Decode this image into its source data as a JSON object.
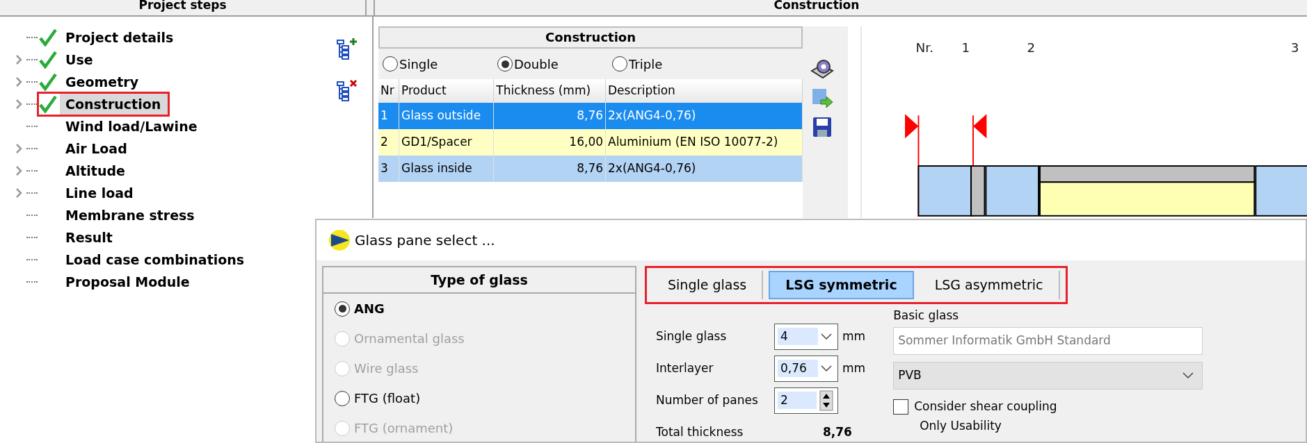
{
  "headers": {
    "left": "Project steps",
    "right": "Construction"
  },
  "tree": [
    {
      "label": "Project details",
      "checked": true,
      "expandable": false,
      "selected": false,
      "highlighted": false
    },
    {
      "label": "Use",
      "checked": true,
      "expandable": true,
      "selected": false,
      "highlighted": false
    },
    {
      "label": "Geometry",
      "checked": true,
      "expandable": true,
      "selected": false,
      "highlighted": false
    },
    {
      "label": "Construction",
      "checked": true,
      "expandable": true,
      "selected": true,
      "highlighted": true
    },
    {
      "label": "Wind load/Lawine",
      "checked": false,
      "expandable": false,
      "selected": false,
      "highlighted": false
    },
    {
      "label": "Air Load",
      "checked": false,
      "expandable": true,
      "selected": false,
      "highlighted": false
    },
    {
      "label": "Altitude",
      "checked": false,
      "expandable": true,
      "selected": false,
      "highlighted": false
    },
    {
      "label": "Line load",
      "checked": false,
      "expandable": true,
      "selected": false,
      "highlighted": false
    },
    {
      "label": "Membrane stress",
      "checked": false,
      "expandable": false,
      "selected": false,
      "highlighted": false
    },
    {
      "label": "Result",
      "checked": false,
      "expandable": false,
      "selected": false,
      "highlighted": false
    },
    {
      "label": "Load case combinations",
      "checked": false,
      "expandable": false,
      "selected": false,
      "highlighted": false
    },
    {
      "label": "Proposal Module",
      "checked": false,
      "expandable": false,
      "selected": false,
      "highlighted": false
    }
  ],
  "construction": {
    "title": "Construction",
    "glazing": [
      {
        "label": "Single",
        "selected": false
      },
      {
        "label": "Double",
        "selected": true
      },
      {
        "label": "Triple",
        "selected": false
      }
    ],
    "columns": [
      "Nr",
      "Product",
      "Thickness (mm)",
      "Description"
    ],
    "rows": [
      {
        "kind": "glass",
        "selected": true,
        "cells": [
          "1",
          "Glass outside",
          "8,76",
          "2x(ANG4-0,76)"
        ]
      },
      {
        "kind": "spacer",
        "selected": false,
        "cells": [
          "2",
          "GD1/Spacer",
          "16,00",
          "Aluminium (EN ISO 10077-2)"
        ]
      },
      {
        "kind": "glass",
        "selected": false,
        "cells": [
          "3",
          "Glass inside",
          "8,76",
          "2x(ANG4-0,76)"
        ]
      }
    ]
  },
  "diagram": {
    "labels": [
      "Nr.",
      "1",
      "2",
      "3"
    ]
  },
  "dialog": {
    "title": "Glass pane select ...",
    "type_header": "Type of glass",
    "types": [
      {
        "label": "ANG",
        "selected": true,
        "disabled": false
      },
      {
        "label": "Ornamental glass",
        "selected": false,
        "disabled": true
      },
      {
        "label": "Wire glass",
        "selected": false,
        "disabled": true
      },
      {
        "label": "FTG (float)",
        "selected": false,
        "disabled": false
      },
      {
        "label": "FTG (ornament)",
        "selected": false,
        "disabled": true
      }
    ],
    "tabs_highlighted": true,
    "tabs": [
      {
        "label": "Single glass",
        "selected": false
      },
      {
        "label": "LSG symmetric",
        "selected": true
      },
      {
        "label": "LSG asymmetric",
        "selected": false
      }
    ],
    "fields": [
      {
        "kind": "combo",
        "label": "Single glass",
        "value": "4",
        "unit": "mm"
      },
      {
        "kind": "combo",
        "label": "Interlayer",
        "value": "0,76",
        "unit": "mm"
      },
      {
        "kind": "spin",
        "label": "Number of panes",
        "value": "2"
      }
    ],
    "basic_glass_label": "Basic glass",
    "basic_glass": "Sommer Informatik GmbH  Standard",
    "interlayer_material": "PVB",
    "shear": {
      "label": "Consider shear coupling",
      "checked": false
    },
    "note": "Only Usability",
    "total_label": "Total thickness",
    "total_value": "8,76"
  }
}
